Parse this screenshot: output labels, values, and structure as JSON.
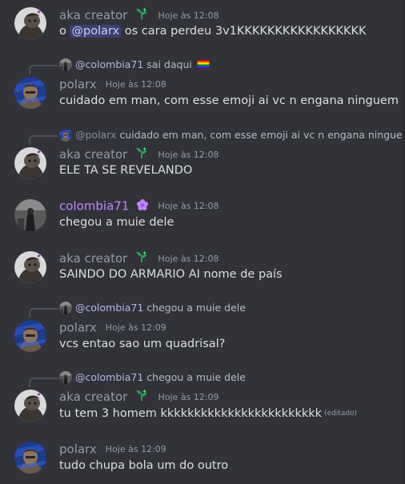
{
  "colors": {
    "background": "#323339",
    "text": "#dbdee1",
    "muted": "#949ba4",
    "aka_name": "#949ba4",
    "polarx_name": "#949ba4",
    "colombia_name": "#c084fc",
    "mention_bg": "#5865f2",
    "badge_green": "#23a55a"
  },
  "messages": [
    {
      "author": "aka creator",
      "timestamp": "Hoje às 12:08",
      "content_pre": "o ",
      "mention": "@polarx",
      "content_post": " os cara perdeu 3v1KKKKKKKKKKKKKKKKK"
    },
    {
      "reply_name": "@colombia71",
      "reply_text": "sai daqui",
      "author": "polarx",
      "timestamp": "Hoje às 12:08",
      "content": "cuidado em man, com esse emoji ai vc n engana ninguem"
    },
    {
      "reply_name": "@polarx",
      "reply_text": "cuidado em man, com esse emoji ai vc n engana ninguem",
      "author": "aka creator",
      "timestamp": "Hoje às 12:08",
      "content": "ELE TA SE REVELANDO"
    },
    {
      "author": "colombia71",
      "timestamp": "Hoje às 12:08",
      "content": "chegou a muie dele"
    },
    {
      "author": "aka creator",
      "timestamp": "Hoje às 12:08",
      "content": "SAINDO DO ARMARIO AI nome de país"
    },
    {
      "reply_name": "@colombia71",
      "reply_text": "chegou a muie dele",
      "author": "polarx",
      "timestamp": "Hoje às 12:09",
      "content": "vcs entao sao um quadrisal?"
    },
    {
      "reply_name": "@colombia71",
      "reply_text": "chegou a muie dele",
      "author": "aka creator",
      "timestamp": "Hoje às 12:09",
      "content": "tu tem 3 homem kkkkkkkkkkkkkkkkkkkkkkkk",
      "edited": "(editado)"
    },
    {
      "author": "polarx",
      "timestamp": "Hoje às 12:09",
      "content": "tudo chupa bola um do outro"
    }
  ]
}
